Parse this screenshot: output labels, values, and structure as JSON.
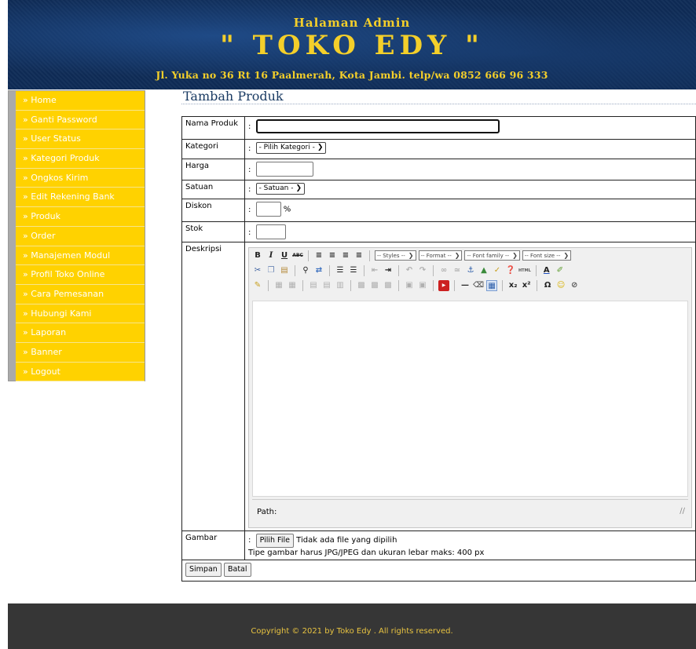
{
  "header": {
    "subtitle": "Halaman Admin",
    "title": "\" TOKO EDY \"",
    "address": "Jl. Yuka no 36 Rt 16 Paalmerah, Kota Jambi. telp/wa 0852 666 96 333"
  },
  "sidebar": {
    "items": [
      {
        "label": "» Home"
      },
      {
        "label": "» Ganti Password"
      },
      {
        "label": "» User Status"
      },
      {
        "label": "» Kategori Produk"
      },
      {
        "label": "» Ongkos Kirim"
      },
      {
        "label": "» Edit Rekening Bank"
      },
      {
        "label": "» Produk"
      },
      {
        "label": "» Order"
      },
      {
        "label": "» Manajemen Modul"
      },
      {
        "label": "» Profil Toko Online"
      },
      {
        "label": "» Cara Pemesanan"
      },
      {
        "label": "» Hubungi Kami"
      },
      {
        "label": "» Laporan"
      },
      {
        "label": "» Banner"
      },
      {
        "label": "» Logout"
      }
    ]
  },
  "page": {
    "title": "Tambah Produk"
  },
  "form": {
    "colon": ":",
    "nama_label": "Nama Produk",
    "nama_value": "",
    "kategori_label": "Kategori",
    "kategori_selected": "- Pilih Kategori -",
    "harga_label": "Harga",
    "harga_value": "",
    "satuan_label": "Satuan",
    "satuan_selected": "- Satuan -",
    "diskon_label": "Diskon",
    "diskon_value": "",
    "diskon_unit": "%",
    "stok_label": "Stok",
    "stok_value": "",
    "deskripsi_label": "Deskripsi",
    "gambar_label": "Gambar",
    "file_button": "Pilih File",
    "file_status": "Tidak ada file yang dipilih",
    "gambar_note": "Tipe gambar harus JPG/JPEG dan ukuran lebar maks: 400 px",
    "save_button": "Simpan",
    "cancel_button": "Batal"
  },
  "editor": {
    "styles_dd": "-- Styles --",
    "format_dd": "-- Format --",
    "fontfamily_dd": "-- Font family --",
    "fontsize_dd": "-- Font size --",
    "path_label": "Path:"
  },
  "footer": {
    "copyright": "Copyright © 2021 by Toko Edy . All rights reserved."
  }
}
